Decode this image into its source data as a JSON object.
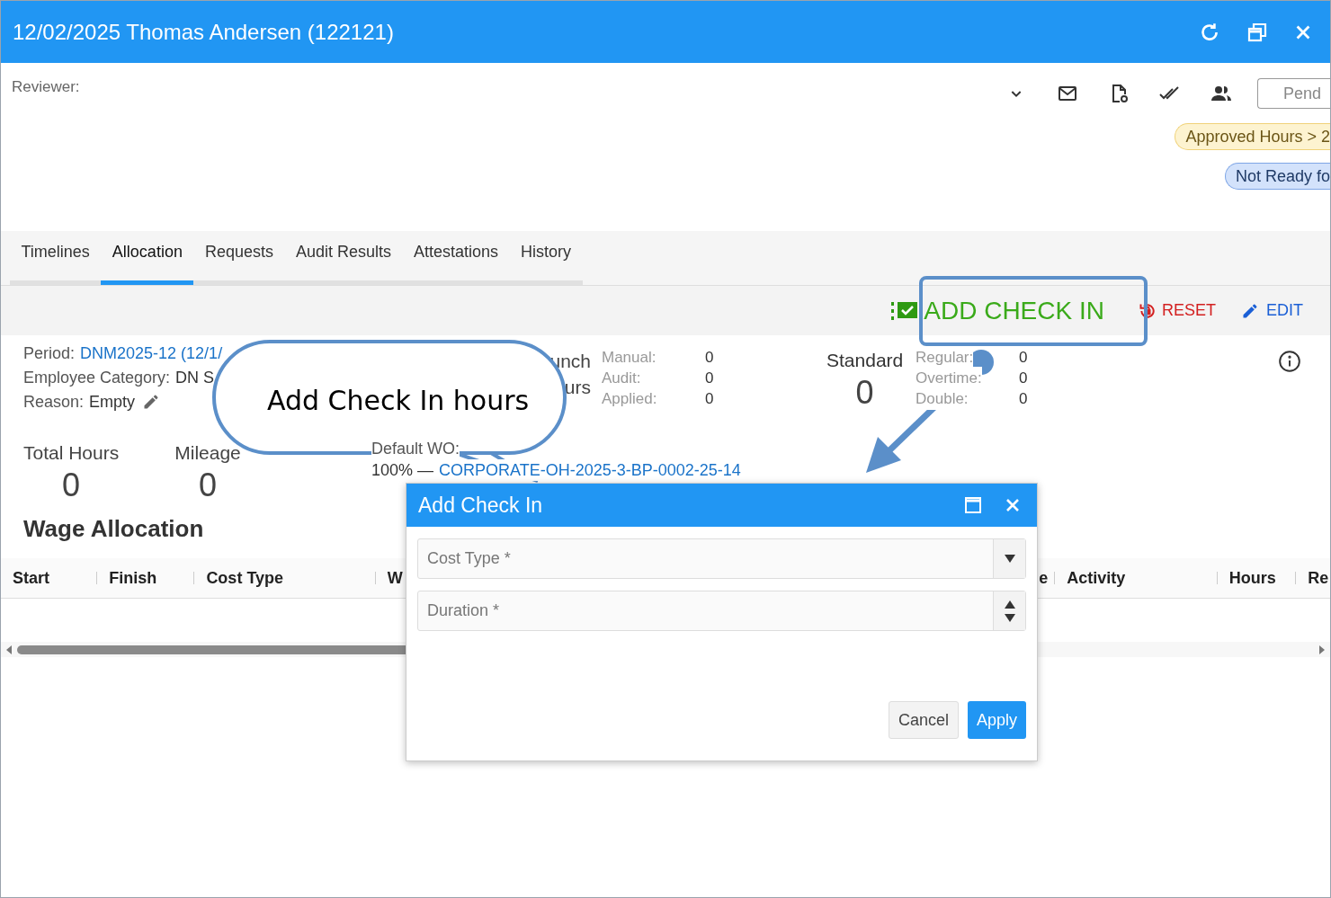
{
  "window": {
    "title": "12/02/2025 Thomas Andersen (122121)"
  },
  "reviewer": {
    "label": "Reviewer:"
  },
  "status_field": {
    "placeholder": "Pend"
  },
  "badges": [
    {
      "kind": "warning",
      "text": "Approved Hours > 2"
    },
    {
      "kind": "info",
      "text": "Not Ready fo"
    }
  ],
  "tabs": [
    {
      "label": "Timelines",
      "selected": false
    },
    {
      "label": "Allocation",
      "selected": true
    },
    {
      "label": "Requests",
      "selected": false
    },
    {
      "label": "Audit Results",
      "selected": false
    },
    {
      "label": "Attestations",
      "selected": false
    },
    {
      "label": "History",
      "selected": false
    }
  ],
  "toolbar": [
    {
      "kind": "add",
      "label": "ADD CHECK IN"
    },
    {
      "kind": "reset",
      "label": "RESET"
    },
    {
      "kind": "edit",
      "label": "EDIT"
    }
  ],
  "details": [
    {
      "label": "Period:",
      "value": "DNM2025-12 (12/1/",
      "kind": "link"
    },
    {
      "label": "Employee Category:",
      "value": "DN S",
      "kind": "text"
    },
    {
      "label": "Reason:",
      "value": "Empty",
      "kind": "editable"
    }
  ],
  "totals": [
    {
      "label": "Total Hours",
      "value": "0"
    },
    {
      "label": "Mileage",
      "value": "0"
    }
  ],
  "punch": {
    "label_lines": [
      "unch",
      "urs"
    ],
    "rows": [
      {
        "label": "Manual:",
        "value": "0"
      },
      {
        "label": "Audit:",
        "value": "0"
      },
      {
        "label": "Applied:",
        "value": "0"
      }
    ]
  },
  "standard": {
    "label": "Standard",
    "value": "0",
    "rows": [
      {
        "label": "Regular:",
        "value": "0"
      },
      {
        "label": "Overtime:",
        "value": "0"
      },
      {
        "label": "Double:",
        "value": "0"
      }
    ]
  },
  "default_wo": {
    "label": "Default WO:",
    "share": "100% —",
    "link": "CORPORATE-OH-2025-3-BP-0002-25-14"
  },
  "section_title": "Wage Allocation",
  "table": {
    "columns": [
      "Start",
      "Finish",
      "Cost Type",
      "W",
      "e",
      "Activity",
      "Hours",
      "Re"
    ]
  },
  "callout": {
    "text": "Add Check In hours"
  },
  "dialog": {
    "title": "Add Check In",
    "fields": [
      {
        "kind": "select",
        "placeholder": "Cost Type *"
      },
      {
        "kind": "number",
        "placeholder": "Duration *"
      }
    ],
    "buttons": [
      {
        "kind": "secondary",
        "label": "Cancel"
      },
      {
        "kind": "primary",
        "label": "Apply"
      }
    ]
  }
}
